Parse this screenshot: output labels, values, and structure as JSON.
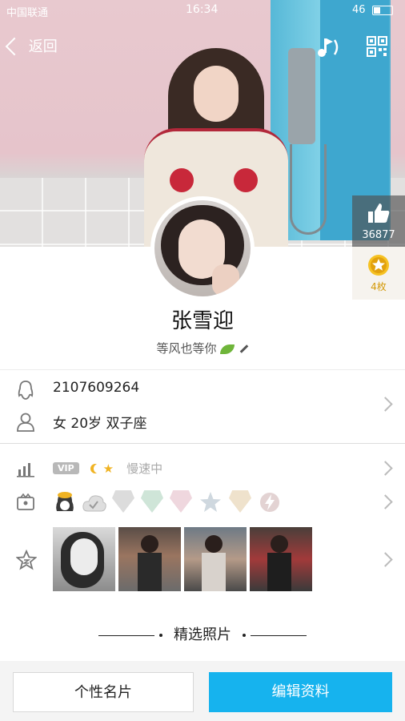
{
  "statusbar": {
    "carrier": "中国联通",
    "time": "16:34",
    "battery": "46"
  },
  "header": {
    "back_label": "返回",
    "like_count": "36877",
    "gift_label": "4枚"
  },
  "profile": {
    "nickname": "张雪迎",
    "signature": "等风也等你"
  },
  "info": {
    "qq_number": "2107609264",
    "personal": "女  20岁  双子座"
  },
  "vip": {
    "badge": "VIP",
    "speed": "慢速中"
  },
  "album": {
    "section_title": "精选照片"
  },
  "actions": {
    "card_label": "个性名片",
    "edit_label": "编辑资料"
  },
  "colors": {
    "accent": "#16b3ee",
    "gold": "#f0b323"
  }
}
